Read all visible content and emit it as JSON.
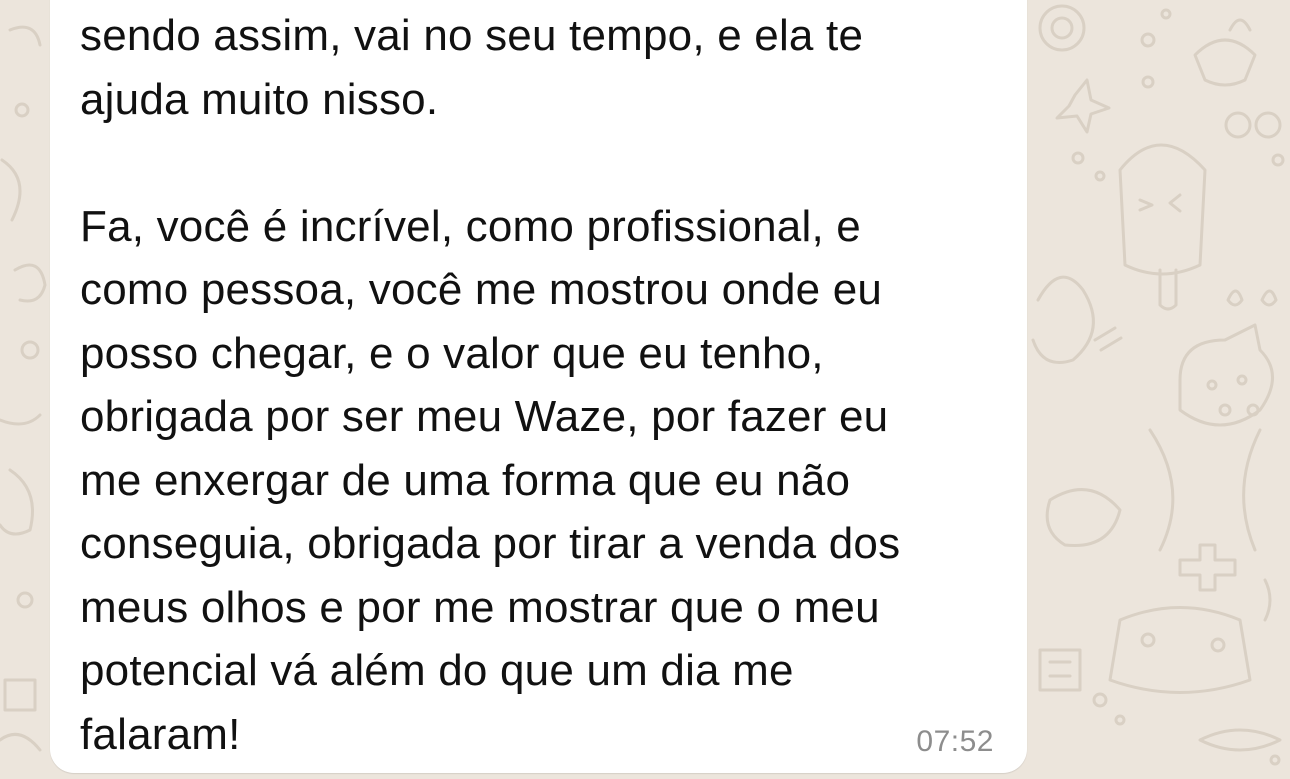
{
  "chat": {
    "message": {
      "text": "sendo assim, vai no seu tempo, e ela te\najuda muito nisso.\n\nFa, você é incrível, como profissional, e\ncomo pessoa, você me mostrou onde eu\nposso chegar, e o valor que eu tenho,\nobrigada por ser meu Waze, por fazer eu\nme enxergar de uma forma que eu não\nconseguia, obrigada por tirar a venda dos\nmeus olhos e por me mostrar que o meu\npotencial vá além do que um dia me\nfalaram!",
      "time": "07:52"
    }
  },
  "colors": {
    "wallpaper": "#ece5dc",
    "doodle": "#d9d0c4",
    "bubble": "#ffffff",
    "text": "#111111",
    "timestamp": "#8d8d8d"
  },
  "icons": [
    "wallpaper-doodle-pattern"
  ]
}
